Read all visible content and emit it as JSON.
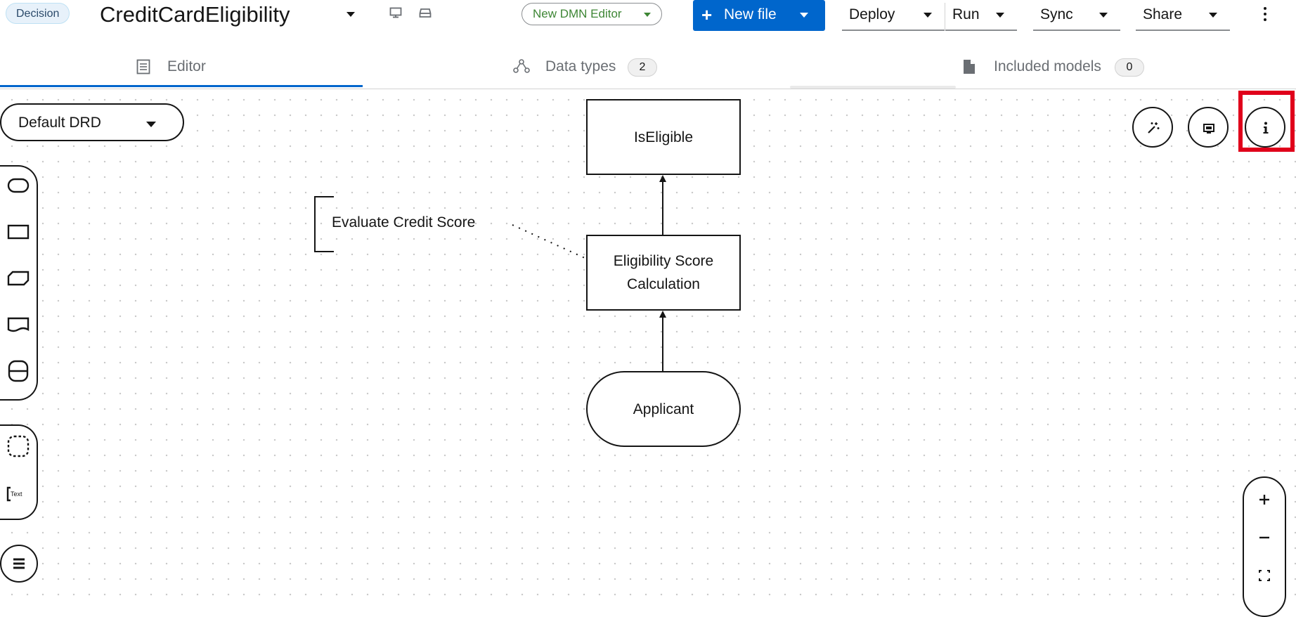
{
  "header": {
    "model_type_badge": "Decision",
    "file_name": "CreditCardEligibility",
    "editor_selector": "New DMN Editor",
    "new_file_label": "New file",
    "deploy_label": "Deploy",
    "run_label": "Run",
    "sync_label": "Sync",
    "share_label": "Share"
  },
  "tabs": [
    {
      "label": "Editor",
      "active": true,
      "icon": "editor-icon"
    },
    {
      "label": "Data types",
      "count": "2",
      "icon": "data-types-icon"
    },
    {
      "label": "Included models",
      "count": "0",
      "icon": "file-icon"
    }
  ],
  "canvas": {
    "drd_selector": "Default DRD",
    "palette": {
      "text_annotation_glyph": "Text",
      "items": [
        "input-data-icon",
        "decision-icon",
        "bkm-icon",
        "knowledge-source-icon",
        "decision-service-icon",
        "group-icon",
        "text-annotation-icon",
        "list-icon"
      ]
    },
    "toolbar_buttons": [
      "auto-layout-icon",
      "overlays-icon",
      "info-icon"
    ],
    "zoom": [
      "zoom-in-icon",
      "zoom-out-icon",
      "fit-to-screen-icon"
    ],
    "nodes": {
      "is_eligible": "IsEligible",
      "eligibility_line1": "Eligibility Score",
      "eligibility_line2": "Calculation",
      "applicant": "Applicant"
    },
    "annotation": "Evaluate Credit Score",
    "highlight_color": "#e0001b",
    "accent_color": "#0066cc"
  }
}
